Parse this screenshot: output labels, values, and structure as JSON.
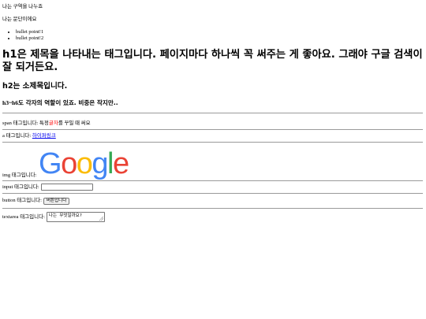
{
  "div_text": "나는 구역을 나누죠",
  "p_text": "나는 문단이에요",
  "bullets": [
    "bullet point!1",
    "bullet point!2"
  ],
  "h1_text": "h1은 제목을 나타내는 태그입니다. 페이지마다 하나씩 꼭 써주는 게 좋아요. 그래야 구글 검색이 잘 되거든요.",
  "h2_text": "h2는 소제목입니다.",
  "h3_lead": "h3~h6",
  "h3_rest": "도 각자의 역할이 있죠. 비중은 작지만..",
  "span_row": {
    "before": "span 태그입니다: 특정 ",
    "highlight": "글자",
    "after": "를 꾸밀 때 써요",
    "highlight_color": "#ff0000"
  },
  "a_row": {
    "label": "a 태그입니다: ",
    "link_text": "하이퍼링크"
  },
  "img_row": {
    "label": "img 태그입니다:",
    "logo_text": "Google",
    "logo_colors": [
      "#4285F4",
      "#EA4335",
      "#FBBC05",
      "#4285F4",
      "#34A853",
      "#EA4335"
    ]
  },
  "input_row": {
    "label": "input 태그입니다:",
    "value": ""
  },
  "button_row": {
    "label": "button 태그입니다:",
    "button_text": "버튼입니다"
  },
  "textarea_row": {
    "label": "textarea 태그입니다:",
    "value": "나는 무엇일까요?"
  }
}
